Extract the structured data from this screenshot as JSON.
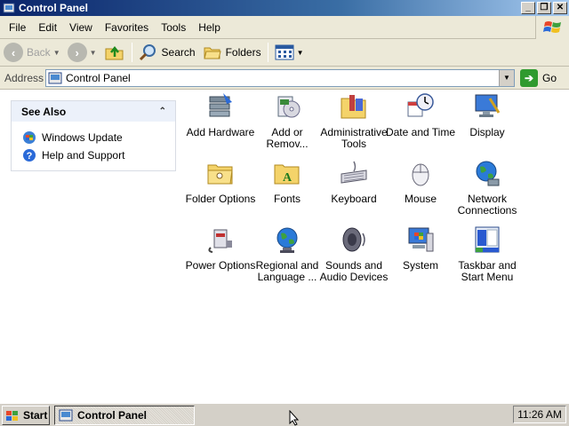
{
  "window": {
    "title": "Control Panel",
    "buttons": {
      "minimize": "_",
      "maximize": "❐",
      "close": "✕"
    }
  },
  "menubar": {
    "items": [
      "File",
      "Edit",
      "View",
      "Favorites",
      "Tools",
      "Help"
    ]
  },
  "toolbar": {
    "back_label": "Back",
    "search_label": "Search",
    "folders_label": "Folders"
  },
  "addressbar": {
    "label": "Address",
    "value": "Control Panel",
    "go_label": "Go"
  },
  "see_also": {
    "title": "See Also",
    "links": [
      {
        "label": "Windows Update",
        "icon": "windows-update-icon"
      },
      {
        "label": "Help and Support",
        "icon": "help-icon"
      }
    ]
  },
  "control_panel_items": [
    {
      "label": "Add Hardware",
      "icon": "add-hardware-icon"
    },
    {
      "label": "Add or Remov...",
      "icon": "add-remove-programs-icon"
    },
    {
      "label": "Administrative Tools",
      "icon": "administrative-tools-icon"
    },
    {
      "label": "Date and Time",
      "icon": "date-time-icon"
    },
    {
      "label": "Display",
      "icon": "display-icon"
    },
    {
      "label": "Folder Options",
      "icon": "folder-options-icon"
    },
    {
      "label": "Fonts",
      "icon": "fonts-icon"
    },
    {
      "label": "Keyboard",
      "icon": "keyboard-icon"
    },
    {
      "label": "Mouse",
      "icon": "mouse-icon"
    },
    {
      "label": "Network Connections",
      "icon": "network-connections-icon"
    },
    {
      "label": "Power Options",
      "icon": "power-options-icon"
    },
    {
      "label": "Regional and Language ...",
      "icon": "regional-language-icon"
    },
    {
      "label": "Sounds and Audio Devices",
      "icon": "sounds-audio-icon"
    },
    {
      "label": "System",
      "icon": "system-icon"
    },
    {
      "label": "Taskbar and Start Menu",
      "icon": "taskbar-start-menu-icon"
    }
  ],
  "taskbar": {
    "start_label": "Start",
    "task_label": "Control Panel",
    "clock": "11:26 AM"
  }
}
